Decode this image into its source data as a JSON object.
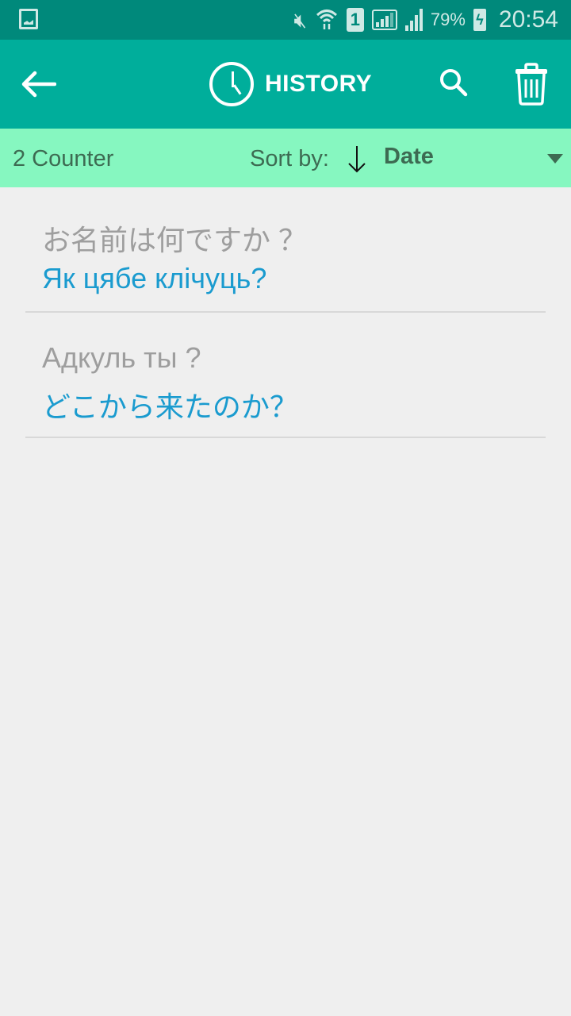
{
  "status_bar": {
    "battery_percent": "79%",
    "time": "20:54",
    "sim_slot": "1",
    "icons": [
      "gallery-notification-icon",
      "vibrate-mute-icon",
      "wifi-icon",
      "sim-icon",
      "signal-icon",
      "signal-icon",
      "battery-charging-icon"
    ]
  },
  "app_bar": {
    "title": "HISTORY",
    "back_icon": "arrow-left-icon",
    "title_icon": "clock-icon",
    "search_icon": "search-icon",
    "delete_icon": "trash-icon",
    "background_color": "#00ae9b"
  },
  "sort_bar": {
    "counter": "2 Counter",
    "sort_label": "Sort by:",
    "sort_direction": "descending",
    "sort_value": "Date",
    "background_color": "#86f7c0"
  },
  "history": {
    "items": [
      {
        "source": "お名前は何ですか ？",
        "translation": "Як цябе клічуць?"
      },
      {
        "source": "Адкуль ты ?",
        "translation": "どこから来たのか？"
      }
    ]
  },
  "colors": {
    "status_bar": "#00897b",
    "source_text": "#9e9e9e",
    "translation_text": "#1a9bcf"
  }
}
